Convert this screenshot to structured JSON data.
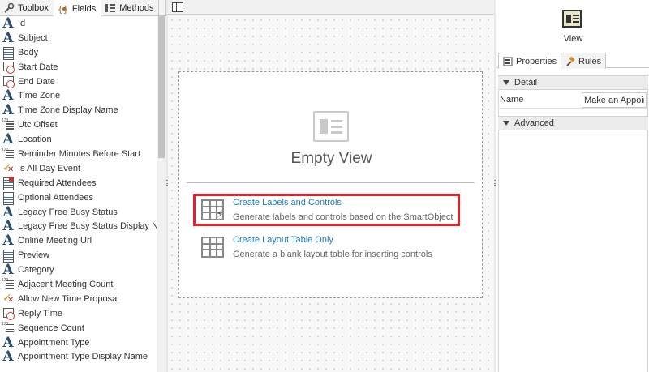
{
  "left_tabs": [
    {
      "label": "Toolbox",
      "icon": "wrench-icon"
    },
    {
      "label": "Fields",
      "icon": "braces-icon"
    },
    {
      "label": "Methods",
      "icon": "methods-icon"
    }
  ],
  "fields": [
    {
      "label": "Id",
      "type": "text"
    },
    {
      "label": "Subject",
      "type": "text"
    },
    {
      "label": "Body",
      "type": "memo"
    },
    {
      "label": "Start Date",
      "type": "date"
    },
    {
      "label": "End Date",
      "type": "date"
    },
    {
      "label": "Time Zone",
      "type": "text"
    },
    {
      "label": "Time Zone Display Name",
      "type": "text"
    },
    {
      "label": "Utc Offset",
      "type": "num"
    },
    {
      "label": "Location",
      "type": "text"
    },
    {
      "label": "Reminder Minutes Before Start",
      "type": "num"
    },
    {
      "label": "Is All Day Event",
      "type": "bool"
    },
    {
      "label": "Required Attendees",
      "type": "multi"
    },
    {
      "label": "Optional Attendees",
      "type": "memo"
    },
    {
      "label": "Legacy Free Busy Status",
      "type": "text"
    },
    {
      "label": "Legacy Free Busy Status Display Na...",
      "type": "text"
    },
    {
      "label": "Online Meeting Url",
      "type": "text"
    },
    {
      "label": "Preview",
      "type": "memo"
    },
    {
      "label": "Category",
      "type": "text"
    },
    {
      "label": "Adjacent Meeting Count",
      "type": "num"
    },
    {
      "label": "Allow New Time Proposal",
      "type": "bool"
    },
    {
      "label": "Reply Time",
      "type": "date"
    },
    {
      "label": "Sequence Count",
      "type": "num"
    },
    {
      "label": "Appointment Type",
      "type": "text"
    },
    {
      "label": "Appointment Type Display Name",
      "type": "text"
    }
  ],
  "canvas": {
    "empty_title": "Empty View",
    "options": [
      {
        "title": "Create Labels and Controls",
        "desc": "Generate labels and controls based on the SmartObject"
      },
      {
        "title": "Create Layout Table Only",
        "desc": "Generate a blank layout table for inserting controls"
      }
    ]
  },
  "right": {
    "view_label": "View",
    "tabs": [
      {
        "label": "Properties",
        "icon": "properties-icon"
      },
      {
        "label": "Rules",
        "icon": "gavel-icon"
      }
    ],
    "section_detail": "Detail",
    "section_advanced": "Advanced",
    "name_label": "Name",
    "name_value": "Make an Appointment"
  },
  "colors": {
    "accent_link": "#1a7bbf",
    "highlight": "#e5222c",
    "field_icon": "#2a4f6e"
  }
}
